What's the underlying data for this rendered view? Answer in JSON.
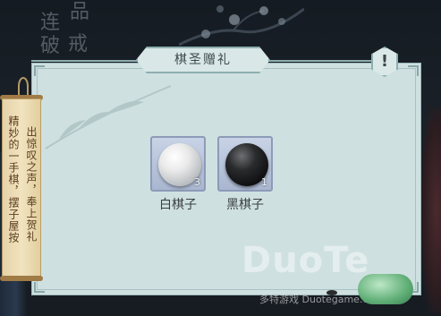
{
  "background": {
    "title_chars": [
      "连",
      "品",
      "破",
      "戒"
    ]
  },
  "scroll": {
    "columns": [
      "出惊叹之声，奉上贺礼",
      "精妙的一手棋，摆子屋按"
    ]
  },
  "panel": {
    "title": "棋圣赠礼",
    "help_label": "!"
  },
  "items": [
    {
      "name": "白棋子",
      "count": "3",
      "stone": "white"
    },
    {
      "name": "黑棋子",
      "count": "1",
      "stone": "black"
    }
  ],
  "watermark": {
    "logo": "DuoTe",
    "sub": "多特游戏 Duotegame.com"
  },
  "colors": {
    "panel_bg": "#cfe0e1",
    "slot_bg": "#b7c3da",
    "scroll_bg": "#efe0bb"
  }
}
